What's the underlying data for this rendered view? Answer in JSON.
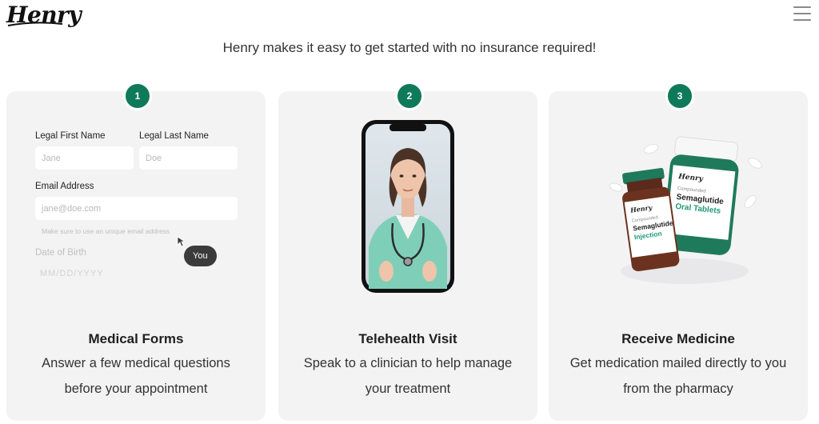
{
  "brand": {
    "logo_text": "Henry"
  },
  "header": {
    "menu_icon": "hamburger-menu-icon"
  },
  "tagline": "Henry makes it easy to get started with no insurance required!",
  "steps": [
    {
      "number": "1",
      "title": "Medical Forms",
      "desc_line1": "Answer a few medical questions",
      "desc_line2": "before your appointment",
      "form": {
        "first_name_label": "Legal First Name",
        "first_name_placeholder": "Jane",
        "last_name_label": "Legal Last Name",
        "last_name_placeholder": "Doe",
        "email_label": "Email Address",
        "email_placeholder": "jane@doe.com",
        "email_hint": "Make sure to use an unique email address",
        "dob_label": "Date of Birth",
        "dob_placeholder": "MM/DD/YYYY",
        "cursor_label": "You"
      }
    },
    {
      "number": "2",
      "title": "Telehealth Visit",
      "desc_line1": "Speak to a clinician to help manage",
      "desc_line2": "your treatment"
    },
    {
      "number": "3",
      "title": "Receive Medicine",
      "desc_line1": "Get medication mailed directly to you",
      "desc_line2": "from the pharmacy",
      "products": {
        "vial_brand": "Henry",
        "vial_sub": "Compounded",
        "vial_name_line1": "Semaglutide",
        "vial_name_line2": "Injection",
        "bottle_brand": "Henry",
        "bottle_sub": "Compounded",
        "bottle_name_line1": "Semaglutide",
        "bottle_name_line2": "Oral Tablets"
      }
    }
  ],
  "colors": {
    "accent": "#0f7a5a",
    "card_bg": "#f3f3f4"
  }
}
